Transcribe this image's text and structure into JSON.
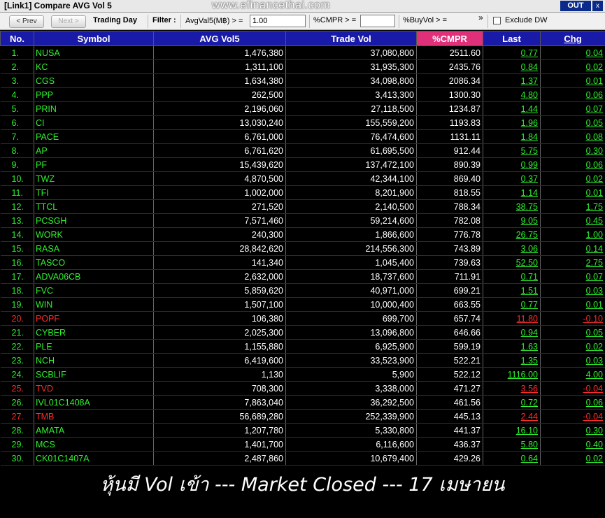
{
  "window": {
    "title": "[Link1] Compare AVG Vol 5",
    "watermark": "www.efinancethai.com",
    "out_label": "OUT",
    "close_label": "x"
  },
  "toolbar": {
    "prev_label": "< Prev",
    "next_label": "Next >",
    "trading_day_label": "Trading Day",
    "filter_label": "Filter :",
    "avgvol_label": "AvgVal5(M฿) > =",
    "avgvol_value": "1.00",
    "cmpr_label": "%CMPR > =",
    "cmpr_value": "",
    "buyvol_label": "%BuyVol > =",
    "buyvol_value": "",
    "more_label": "»",
    "exclude_dw_label": "Exclude DW"
  },
  "columns": [
    "No.",
    "Symbol",
    "AVG Vol5",
    "Trade Vol",
    "%CMPR",
    "Last",
    "Chg"
  ],
  "colors": {
    "up": "#2ef02e",
    "down": "#ff2a2a",
    "header": "#1a1aa8",
    "sort_header": "#e0307a"
  },
  "rows": [
    {
      "no": "1.",
      "symbol": "NUSA",
      "avg": "1,476,380",
      "trade": "37,080,800",
      "cmpr": "2511.60",
      "last": "0.77",
      "chg": "0.04",
      "dir": "up"
    },
    {
      "no": "2.",
      "symbol": "KC",
      "avg": "1,311,100",
      "trade": "31,935,300",
      "cmpr": "2435.76",
      "last": "0.84",
      "chg": "0.02",
      "dir": "up"
    },
    {
      "no": "3.",
      "symbol": "CGS",
      "avg": "1,634,380",
      "trade": "34,098,800",
      "cmpr": "2086.34",
      "last": "1.37",
      "chg": "0.01",
      "dir": "up"
    },
    {
      "no": "4.",
      "symbol": "PPP",
      "avg": "262,500",
      "trade": "3,413,300",
      "cmpr": "1300.30",
      "last": "4.80",
      "chg": "0.06",
      "dir": "up"
    },
    {
      "no": "5.",
      "symbol": "PRIN",
      "avg": "2,196,060",
      "trade": "27,118,500",
      "cmpr": "1234.87",
      "last": "1.44",
      "chg": "0.07",
      "dir": "up"
    },
    {
      "no": "6.",
      "symbol": "CI",
      "avg": "13,030,240",
      "trade": "155,559,200",
      "cmpr": "1193.83",
      "last": "1.96",
      "chg": "0.05",
      "dir": "up"
    },
    {
      "no": "7.",
      "symbol": "PACE",
      "avg": "6,761,000",
      "trade": "76,474,600",
      "cmpr": "1131.11",
      "last": "1.84",
      "chg": "0.08",
      "dir": "up"
    },
    {
      "no": "8.",
      "symbol": "AP",
      "avg": "6,761,620",
      "trade": "61,695,500",
      "cmpr": "912.44",
      "last": "5.75",
      "chg": "0.30",
      "dir": "up"
    },
    {
      "no": "9.",
      "symbol": "PF",
      "avg": "15,439,620",
      "trade": "137,472,100",
      "cmpr": "890.39",
      "last": "0.99",
      "chg": "0.06",
      "dir": "up"
    },
    {
      "no": "10.",
      "symbol": "TWZ",
      "avg": "4,870,500",
      "trade": "42,344,100",
      "cmpr": "869.40",
      "last": "0.37",
      "chg": "0.02",
      "dir": "up"
    },
    {
      "no": "11.",
      "symbol": "TFI",
      "avg": "1,002,000",
      "trade": "8,201,900",
      "cmpr": "818.55",
      "last": "1.14",
      "chg": "0.01",
      "dir": "up"
    },
    {
      "no": "12.",
      "symbol": "TTCL",
      "avg": "271,520",
      "trade": "2,140,500",
      "cmpr": "788.34",
      "last": "38.75",
      "chg": "1.75",
      "dir": "up"
    },
    {
      "no": "13.",
      "symbol": "PCSGH",
      "avg": "7,571,460",
      "trade": "59,214,600",
      "cmpr": "782.08",
      "last": "9.05",
      "chg": "0.45",
      "dir": "up"
    },
    {
      "no": "14.",
      "symbol": "WORK",
      "avg": "240,300",
      "trade": "1,866,600",
      "cmpr": "776.78",
      "last": "26.75",
      "chg": "1.00",
      "dir": "up"
    },
    {
      "no": "15.",
      "symbol": "RASA",
      "avg": "28,842,620",
      "trade": "214,556,300",
      "cmpr": "743.89",
      "last": "3.06",
      "chg": "0.14",
      "dir": "up"
    },
    {
      "no": "16.",
      "symbol": "TASCO",
      "avg": "141,340",
      "trade": "1,045,400",
      "cmpr": "739.63",
      "last": "52.50",
      "chg": "2.75",
      "dir": "up"
    },
    {
      "no": "17.",
      "symbol": "ADVA06CB",
      "avg": "2,632,000",
      "trade": "18,737,600",
      "cmpr": "711.91",
      "last": "0.71",
      "chg": "0.07",
      "dir": "up"
    },
    {
      "no": "18.",
      "symbol": "FVC",
      "avg": "5,859,620",
      "trade": "40,971,000",
      "cmpr": "699.21",
      "last": "1.51",
      "chg": "0.03",
      "dir": "up"
    },
    {
      "no": "19.",
      "symbol": "WIN",
      "avg": "1,507,100",
      "trade": "10,000,400",
      "cmpr": "663.55",
      "last": "0.77",
      "chg": "0.01",
      "dir": "up"
    },
    {
      "no": "20.",
      "symbol": "POPF",
      "avg": "106,380",
      "trade": "699,700",
      "cmpr": "657.74",
      "last": "11.80",
      "chg": "-0.10",
      "dir": "down"
    },
    {
      "no": "21.",
      "symbol": "CYBER",
      "avg": "2,025,300",
      "trade": "13,096,800",
      "cmpr": "646.66",
      "last": "0.94",
      "chg": "0.05",
      "dir": "up"
    },
    {
      "no": "22.",
      "symbol": "PLE",
      "avg": "1,155,880",
      "trade": "6,925,900",
      "cmpr": "599.19",
      "last": "1.63",
      "chg": "0.02",
      "dir": "up"
    },
    {
      "no": "23.",
      "symbol": "NCH",
      "avg": "6,419,600",
      "trade": "33,523,900",
      "cmpr": "522.21",
      "last": "1.35",
      "chg": "0.03",
      "dir": "up"
    },
    {
      "no": "24.",
      "symbol": "SCBLIF",
      "avg": "1,130",
      "trade": "5,900",
      "cmpr": "522.12",
      "last": "1116.00",
      "chg": "4.00",
      "dir": "up"
    },
    {
      "no": "25.",
      "symbol": "TVD",
      "avg": "708,300",
      "trade": "3,338,000",
      "cmpr": "471.27",
      "last": "3.56",
      "chg": "-0.04",
      "dir": "down"
    },
    {
      "no": "26.",
      "symbol": "IVL01C1408A",
      "avg": "7,863,040",
      "trade": "36,292,500",
      "cmpr": "461.56",
      "last": "0.72",
      "chg": "0.06",
      "dir": "up"
    },
    {
      "no": "27.",
      "symbol": "TMB",
      "avg": "56,689,280",
      "trade": "252,339,900",
      "cmpr": "445.13",
      "last": "2.44",
      "chg": "-0.04",
      "dir": "down"
    },
    {
      "no": "28.",
      "symbol": "AMATA",
      "avg": "1,207,780",
      "trade": "5,330,800",
      "cmpr": "441.37",
      "last": "16.10",
      "chg": "0.30",
      "dir": "up"
    },
    {
      "no": "29.",
      "symbol": "MCS",
      "avg": "1,401,700",
      "trade": "6,116,600",
      "cmpr": "436.37",
      "last": "5.80",
      "chg": "0.40",
      "dir": "up"
    },
    {
      "no": "30.",
      "symbol": "CK01C1407A",
      "avg": "2,487,860",
      "trade": "10,679,400",
      "cmpr": "429.26",
      "last": "0.64",
      "chg": "0.02",
      "dir": "up"
    }
  ],
  "caption": "หุ้นมี Vol เข้า --- Market Closed --- 17 เมษายน"
}
